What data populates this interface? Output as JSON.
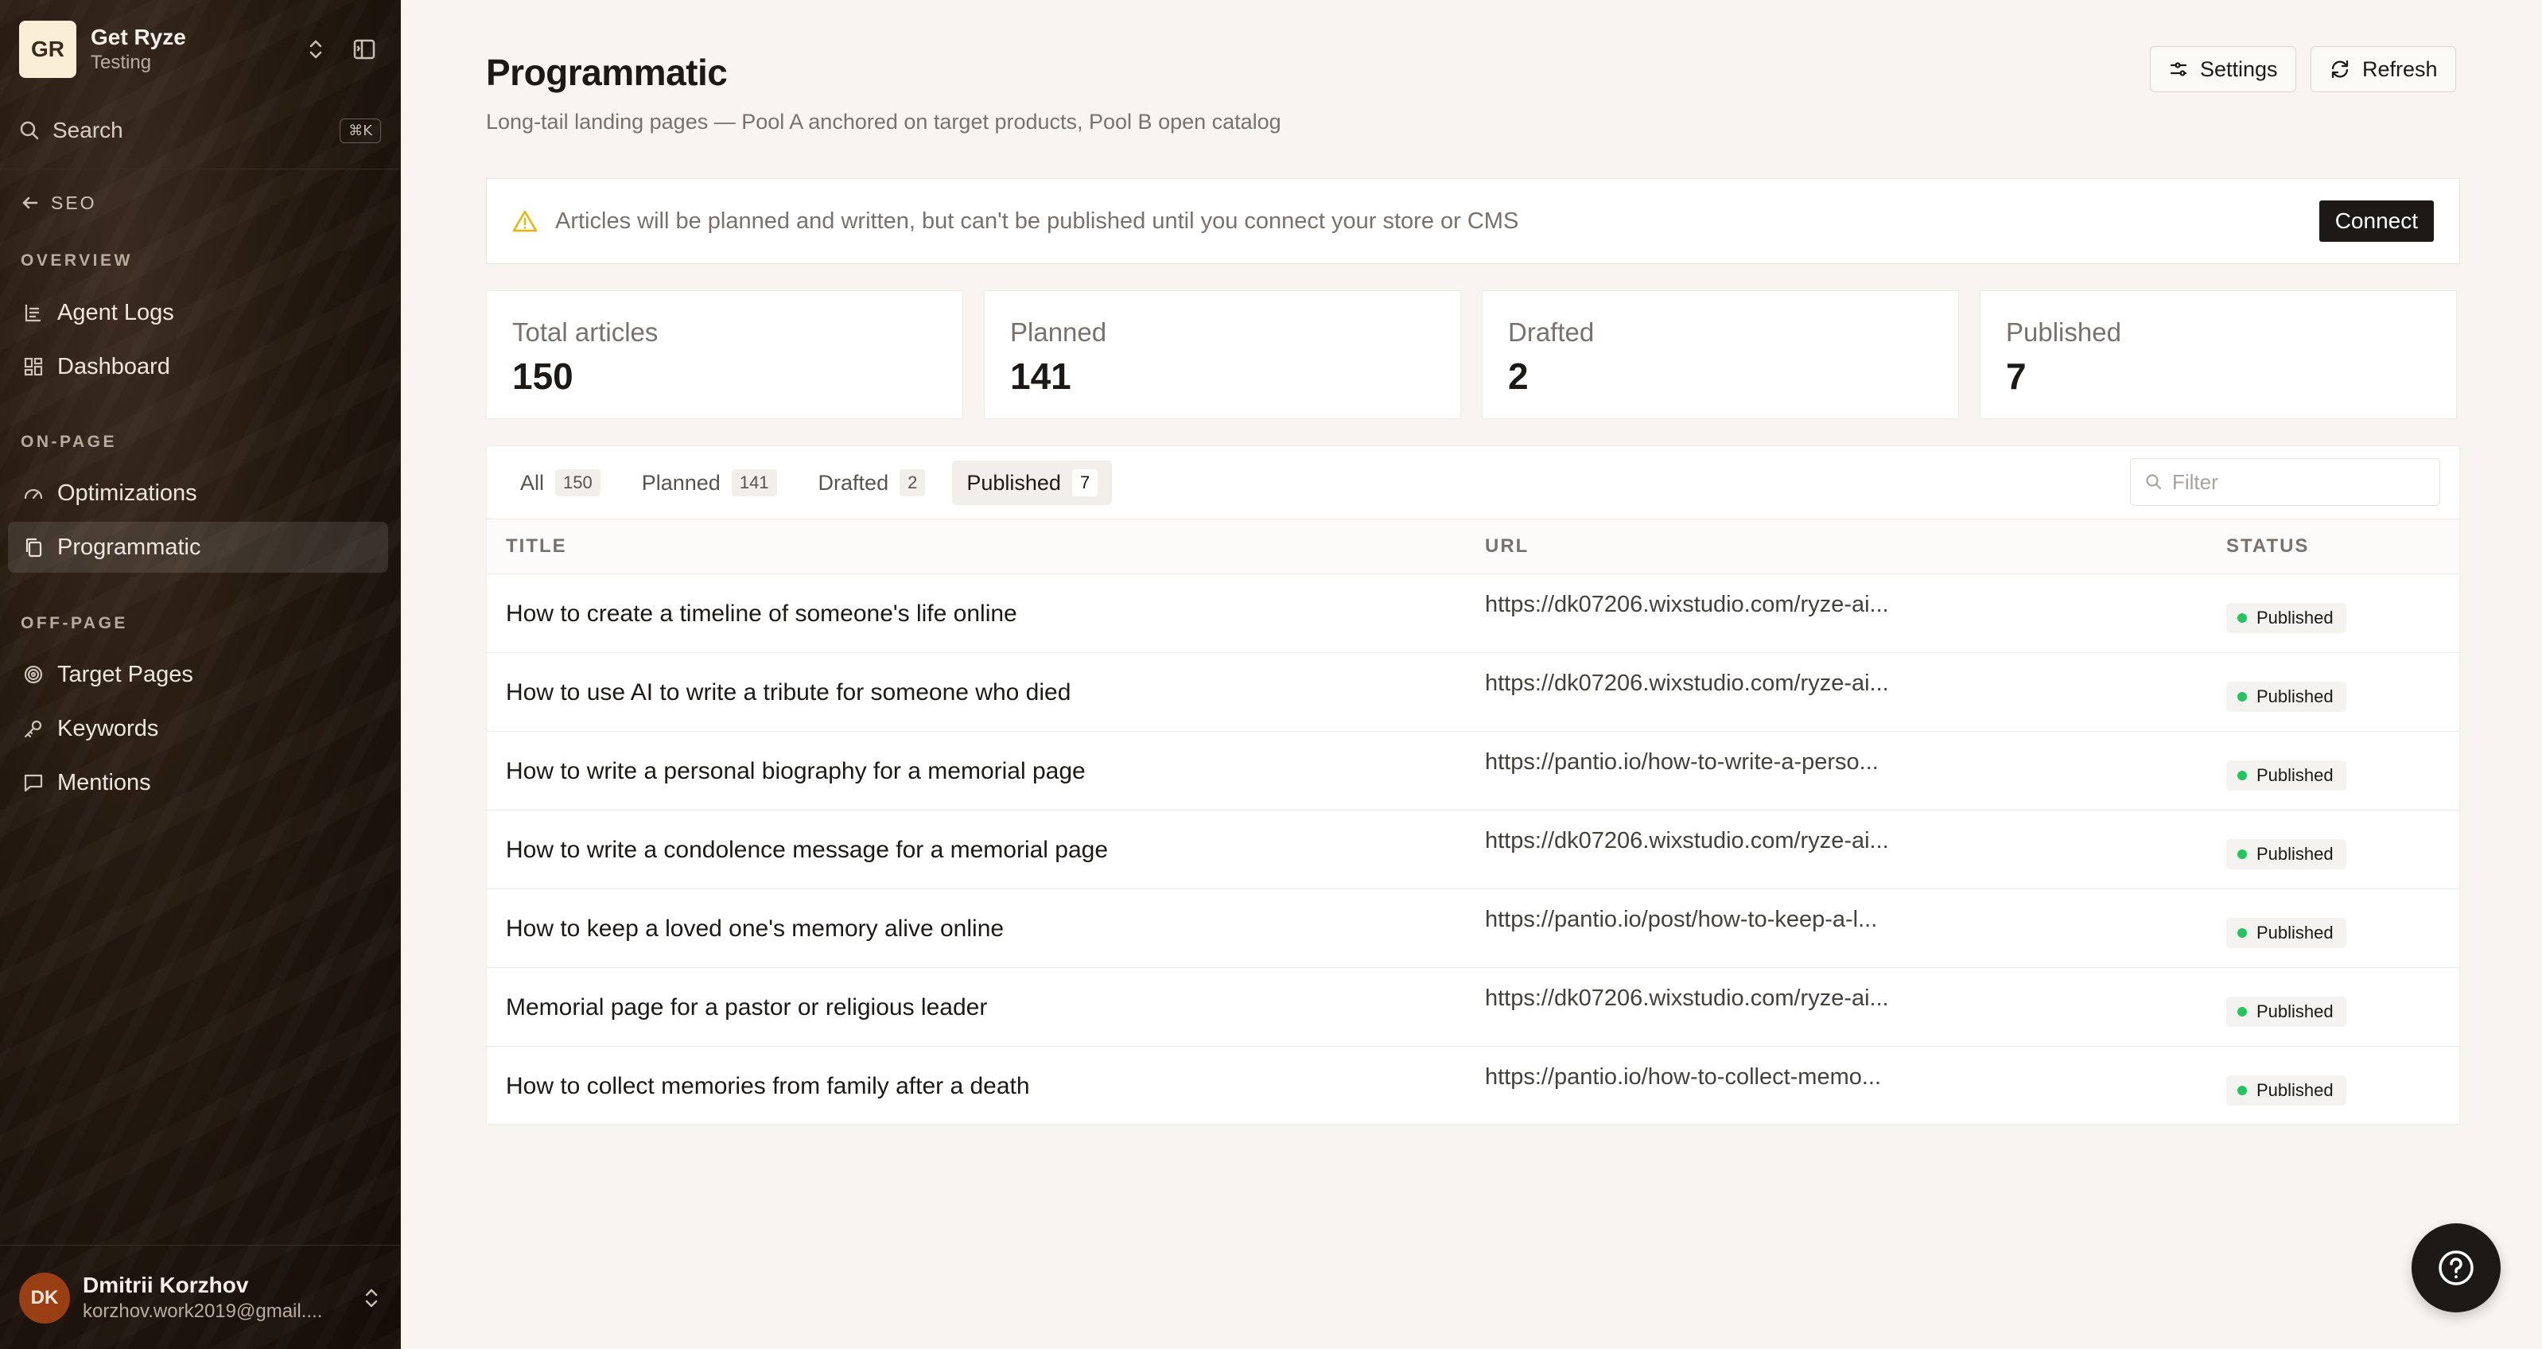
{
  "workspace": {
    "initials": "GR",
    "name": "Get Ryze",
    "subtitle": "Testing"
  },
  "search": {
    "label": "Search",
    "shortcut": "⌘K"
  },
  "back": {
    "label": "SEO"
  },
  "sidebar": {
    "sections": [
      {
        "title": "OVERVIEW",
        "items": [
          {
            "label": "Agent Logs",
            "icon": "logs-icon"
          },
          {
            "label": "Dashboard",
            "icon": "grid-icon"
          }
        ]
      },
      {
        "title": "ON-PAGE",
        "items": [
          {
            "label": "Optimizations",
            "icon": "gauge-icon"
          },
          {
            "label": "Programmatic",
            "icon": "copy-icon",
            "active": true
          }
        ]
      },
      {
        "title": "OFF-PAGE",
        "items": [
          {
            "label": "Target Pages",
            "icon": "target-icon"
          },
          {
            "label": "Keywords",
            "icon": "key-icon"
          },
          {
            "label": "Mentions",
            "icon": "message-icon"
          }
        ]
      }
    ]
  },
  "user": {
    "initials": "DK",
    "name": "Dmitrii Korzhov",
    "email": "korzhov.work2019@gmail...."
  },
  "header": {
    "title": "Programmatic",
    "subtitle": "Long-tail landing pages — Pool A anchored on target products, Pool B open catalog",
    "settings_label": "Settings",
    "refresh_label": "Refresh"
  },
  "banner": {
    "message": "Articles will be planned and written, but can't be published until you connect your store or CMS",
    "button_label": "Connect"
  },
  "stats": [
    {
      "label": "Total articles",
      "value": "150"
    },
    {
      "label": "Planned",
      "value": "141"
    },
    {
      "label": "Drafted",
      "value": "2"
    },
    {
      "label": "Published",
      "value": "7"
    }
  ],
  "tabs": [
    {
      "label": "All",
      "count": "150"
    },
    {
      "label": "Planned",
      "count": "141"
    },
    {
      "label": "Drafted",
      "count": "2"
    },
    {
      "label": "Published",
      "count": "7",
      "active": true
    }
  ],
  "filter": {
    "placeholder": "Filter"
  },
  "table": {
    "columns": [
      "TITLE",
      "URL",
      "STATUS"
    ],
    "rows": [
      {
        "title": "How to create a timeline of someone's life online",
        "url": "https://dk07206.wixstudio.com/ryze-ai...",
        "status": "Published"
      },
      {
        "title": "How to use AI to write a tribute for someone who died",
        "url": "https://dk07206.wixstudio.com/ryze-ai...",
        "status": "Published"
      },
      {
        "title": "How to write a personal biography for a memorial page",
        "url": "https://pantio.io/how-to-write-a-perso...",
        "status": "Published"
      },
      {
        "title": "How to write a condolence message for a memorial page",
        "url": "https://dk07206.wixstudio.com/ryze-ai...",
        "status": "Published"
      },
      {
        "title": "How to keep a loved one's memory alive online",
        "url": "https://pantio.io/post/how-to-keep-a-l...",
        "status": "Published"
      },
      {
        "title": "Memorial page for a pastor or religious leader",
        "url": "https://dk07206.wixstudio.com/ryze-ai...",
        "status": "Published"
      },
      {
        "title": "How to collect memories from family after a death",
        "url": "https://pantio.io/how-to-collect-memo...",
        "status": "Published"
      }
    ]
  },
  "colors": {
    "accent": "#1c1917",
    "published_dot": "#22c55e",
    "warning": "#eab308",
    "user_avatar": "#9a3e14"
  }
}
